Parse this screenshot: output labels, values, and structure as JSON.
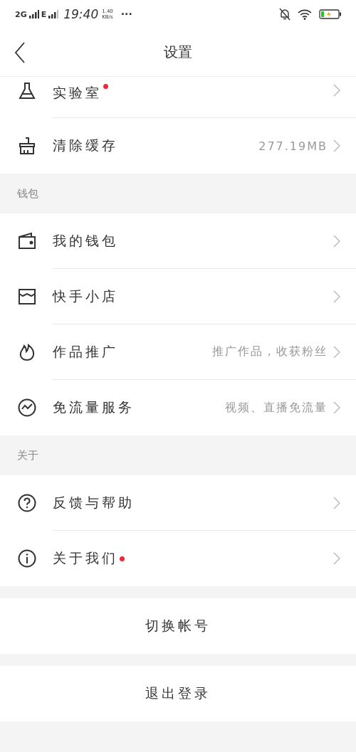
{
  "status_bar": {
    "network_1": "2G",
    "network_2": "E",
    "time": "19:40",
    "speed": "1.40",
    "speed_unit": "KB/s",
    "more": "···"
  },
  "header": {
    "title": "设置"
  },
  "sections": [
    {
      "rows": [
        {
          "label": "实验室",
          "badge": true
        },
        {
          "label": "清除缓存",
          "detail": "277.19MB",
          "badge": false
        }
      ]
    },
    {
      "title": "钱包",
      "rows": [
        {
          "label": "我的钱包",
          "badge": false
        },
        {
          "label": "快手小店",
          "badge": false
        },
        {
          "label": "作品推广",
          "detail": "推广作品，收获粉丝",
          "badge": false
        },
        {
          "label": "免流量服务",
          "detail": "视频、直播免流量",
          "badge": false
        }
      ]
    },
    {
      "title": "关于",
      "rows": [
        {
          "label": "反馈与帮助",
          "badge": false
        },
        {
          "label": "关于我们",
          "badge": true
        }
      ]
    }
  ],
  "actions": [
    "切换帐号",
    "退出登录"
  ]
}
